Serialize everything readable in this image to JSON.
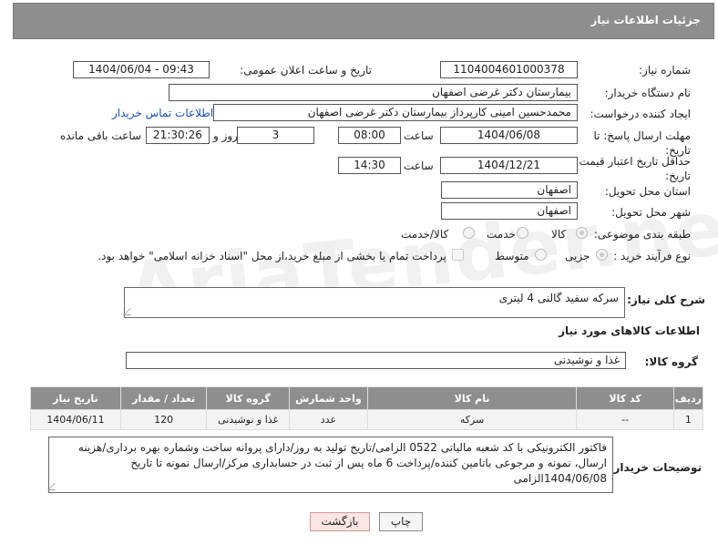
{
  "header": {
    "title": "جزئیات اطلاعات نیاز"
  },
  "form": {
    "need_number_label": "شماره نیاز:",
    "need_number": "1104004601000378",
    "announce_label": "تاریخ و ساعت اعلان عمومی:",
    "announce_value": "1404/06/04 - 09:43",
    "buyer_org_label": "نام دستگاه خریدار:",
    "buyer_org": "بیمارستان دکتر غرضی اصفهان",
    "creator_label": "ایجاد کننده درخواست:",
    "creator": "محمدحسین امینی کارپرداز بیمارستان دکتر غرضی اصفهان",
    "contact_link": "اطلاعات تماس خریدار",
    "deadline_label": "مهلت ارسال پاسخ: تا تاریخ:",
    "deadline_date": "1404/06/08",
    "time_label": "ساعت",
    "deadline_time": "08:00",
    "days_value": "3",
    "days_label": "روز و",
    "remaining_value": "21:30:26",
    "remaining_label": "ساعت باقی مانده",
    "price_validity_label": "حداقل تاریخ اعتبار قیمت: تا تاریخ:",
    "price_validity_date": "1404/12/21",
    "price_validity_time": "14:30",
    "province_label": "استان محل تحویل:",
    "province": "اصفهان",
    "city_label": "شهر محل تحویل:",
    "city": "اصفهان",
    "category_label": "طبقه بندی موضوعی:",
    "category_options": [
      "کالا",
      "خدمت",
      "کالا/خدمت"
    ],
    "category_selected": "کالا",
    "process_label": "نوع فرآیند خرید :",
    "process_options": [
      "جزیی",
      "متوسط"
    ],
    "process_selected": "جزیی",
    "payment_note": "پرداخت تمام یا بخشی از مبلغ خرید،از محل \"اسناد خزانه اسلامی\" خواهد بود."
  },
  "summary": {
    "label": "شرح کلی نیاز:",
    "value": "سرکه سفید گالنی 4 لیتری"
  },
  "goods_section": {
    "title": "اطلاعات کالاهای مورد نیاز",
    "group_label": "گروه کالا:",
    "group_value": "غذا و نوشیدنی"
  },
  "table": {
    "headers": [
      "ردیف",
      "کد کالا",
      "نام کالا",
      "واحد شمارش",
      "گروه کالا",
      "تعداد / مقدار",
      "تاریخ نیاز"
    ],
    "rows": [
      [
        "1",
        "--",
        "سرکه",
        "عدد",
        "غذا و نوشیدنی",
        "120",
        "1404/06/11"
      ]
    ]
  },
  "buyer_notes": {
    "label": "توضیحات خریدار:",
    "value": "فاکتور الکترونیکی با کد شعبه مالیاتی 0522 الزامی/تاریخ تولید به روز/دارای پروانه ساخت وشماره بهره برداری/هزینه ارسال، نمونه و مرجوعی باتامین کننده/پرداخت 6 ماه پس از ثبت در حسابداری مرکز/ارسال نمونه تا تاریخ 1404/06/08الزامی"
  },
  "buttons": {
    "print": "چاپ",
    "back": "بازگشت"
  },
  "watermark": "AriaTender.neT"
}
